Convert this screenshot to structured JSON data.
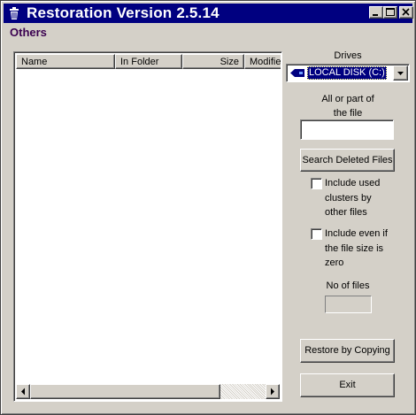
{
  "window": {
    "title": "Restoration Version 2.5.14",
    "icon": "trash-bin-icon",
    "controls": [
      "minimize",
      "maximize",
      "close"
    ]
  },
  "menu": {
    "others_label": "Others"
  },
  "file_list": {
    "columns": [
      "Name",
      "In Folder",
      "Size",
      "Modified"
    ],
    "rows": []
  },
  "drives": {
    "label": "Drives",
    "selected": "LOCAL DISK (C:)",
    "icon": "disk-drive-icon"
  },
  "search": {
    "label_line1": "All or part of",
    "label_line2": "the file",
    "value": "",
    "button_label": "Search Deleted Files"
  },
  "options": {
    "include_used_clusters": {
      "line1": "Include used",
      "line2": "clusters by",
      "line3": "other files",
      "checked": false
    },
    "include_zero_size": {
      "line1": "Include even if",
      "line2": "the file size is",
      "line3": "zero",
      "checked": false
    }
  },
  "file_count": {
    "label": "No of files",
    "value": ""
  },
  "actions": {
    "restore_label": "Restore by Copying",
    "exit_label": "Exit"
  },
  "colors": {
    "titlebar": "#000080",
    "face": "#d4d0c8",
    "menu_text": "#3a0050",
    "selection": "#000080"
  }
}
